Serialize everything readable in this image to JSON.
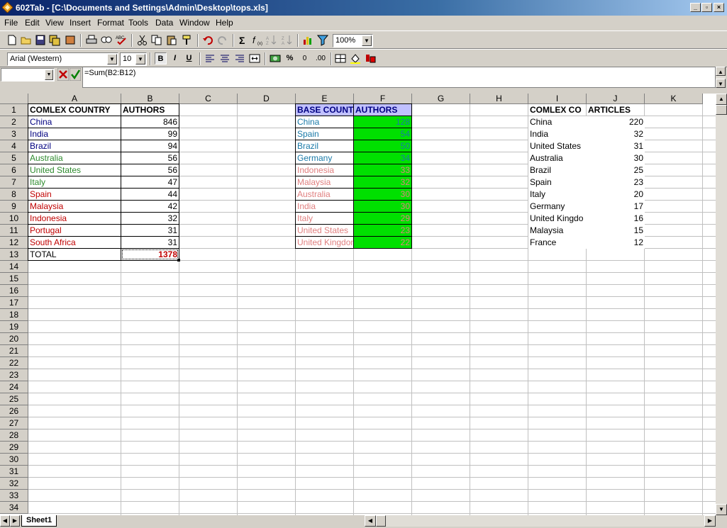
{
  "window": {
    "title": "602Tab - [C:\\Documents and Settings\\Admin\\Desktop\\tops.xls]"
  },
  "menu": [
    "File",
    "Edit",
    "View",
    "Insert",
    "Format",
    "Tools",
    "Data",
    "Window",
    "Help"
  ],
  "toolbar": {
    "zoom": "100%"
  },
  "format_toolbar": {
    "font": "Arial (Western)",
    "size": "10",
    "bold": "B",
    "italic": "I",
    "underline": "U",
    "percent": "%",
    "zero": "0",
    "decimals": ".00"
  },
  "formula_bar": {
    "name_box": "",
    "formula": "=Sum(B2:B12)"
  },
  "columns": [
    "A",
    "B",
    "C",
    "D",
    "E",
    "F",
    "G",
    "H",
    "I",
    "J",
    "K"
  ],
  "rows": [
    "1",
    "2",
    "3",
    "4",
    "5",
    "6",
    "7",
    "8",
    "9",
    "10",
    "11",
    "12",
    "13",
    "14",
    "15",
    "16",
    "17",
    "18",
    "19",
    "20",
    "21",
    "22",
    "23",
    "24",
    "25",
    "26",
    "27",
    "28",
    "29",
    "30",
    "31",
    "32",
    "33",
    "34"
  ],
  "table1": {
    "headers": [
      "COMLEX COUNTRY",
      "AUTHORS"
    ],
    "rows": [
      {
        "country": "China",
        "value": "846",
        "color": "#000080"
      },
      {
        "country": "India",
        "value": "99",
        "color": "#000080"
      },
      {
        "country": "Brazil",
        "value": "94",
        "color": "#000080"
      },
      {
        "country": "Australia",
        "value": "56",
        "color": "#2e8b2e"
      },
      {
        "country": "United States",
        "value": "56",
        "color": "#2e8b2e"
      },
      {
        "country": "Italy",
        "value": "47",
        "color": "#2e8b2e"
      },
      {
        "country": "Spain",
        "value": "44",
        "color": "#c00000"
      },
      {
        "country": "Malaysia",
        "value": "42",
        "color": "#c00000"
      },
      {
        "country": "Indonesia",
        "value": "32",
        "color": "#c00000"
      },
      {
        "country": "Portugal",
        "value": "31",
        "color": "#c00000"
      },
      {
        "country": "South Africa",
        "value": "31",
        "color": "#c00000"
      }
    ],
    "total_label": "TOTAL",
    "total_value": "1378"
  },
  "table2": {
    "headers": [
      "BASE COUNTRY",
      "AUTHORS"
    ],
    "header_bg": "#c0c0ff",
    "value_bg": "#00e000",
    "rows": [
      {
        "country": "China",
        "value": "128",
        "color": "#1a7aa8"
      },
      {
        "country": "Spain",
        "value": "54",
        "color": "#1a7aa8"
      },
      {
        "country": "Brazil",
        "value": "50",
        "color": "#1a7aa8"
      },
      {
        "country": "Germany",
        "value": "34",
        "color": "#1a7aa8"
      },
      {
        "country": "Indonesia",
        "value": "33",
        "color": "#e08080"
      },
      {
        "country": "Malaysia",
        "value": "32",
        "color": "#e08080"
      },
      {
        "country": "Australia",
        "value": "30",
        "color": "#e08080"
      },
      {
        "country": "India",
        "value": "30",
        "color": "#e08080"
      },
      {
        "country": "Italy",
        "value": "29",
        "color": "#e08080"
      },
      {
        "country": "United States",
        "value": "23",
        "color": "#e08080"
      },
      {
        "country": "United Kingdom",
        "value": "22",
        "color": "#e08080"
      }
    ]
  },
  "table3": {
    "headers": [
      "COMLEX CO",
      "ARTICLES"
    ],
    "rows": [
      {
        "country": "China",
        "value": "220"
      },
      {
        "country": "India",
        "value": "32"
      },
      {
        "country": "United States",
        "value": "31"
      },
      {
        "country": "Australia",
        "value": "30"
      },
      {
        "country": "Brazil",
        "value": "25"
      },
      {
        "country": "Spain",
        "value": "23"
      },
      {
        "country": "Italy",
        "value": "20"
      },
      {
        "country": "Germany",
        "value": "17"
      },
      {
        "country": "United Kingdo",
        "value": "16"
      },
      {
        "country": "Malaysia",
        "value": "15"
      },
      {
        "country": "France",
        "value": "12"
      }
    ]
  },
  "sheet_tabs": [
    "Sheet1"
  ]
}
